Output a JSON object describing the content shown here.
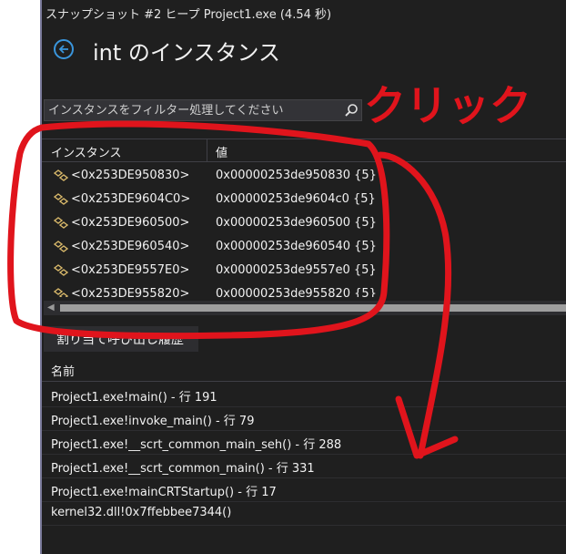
{
  "window": {
    "title": "スナップショット #2 ヒープ Project1.exe (4.54 秒)"
  },
  "page": {
    "title": "int のインスタンス"
  },
  "filter": {
    "placeholder": "インスタンスをフィルター処理してください"
  },
  "table": {
    "headers": {
      "instance": "インスタンス",
      "value": "値"
    },
    "rows": [
      {
        "instance": "<0x253DE950830>",
        "value": "0x00000253de950830 {5}"
      },
      {
        "instance": "<0x253DE9604C0>",
        "value": "0x00000253de9604c0 {5}"
      },
      {
        "instance": "<0x253DE960500>",
        "value": "0x00000253de960500 {5}"
      },
      {
        "instance": "<0x253DE960540>",
        "value": "0x00000253de960540 {5}"
      },
      {
        "instance": "<0x253DE9557E0>",
        "value": "0x00000253de9557e0 {5}"
      },
      {
        "instance": "<0x253DE955820>",
        "value": "0x00000253de955820 {5}"
      }
    ]
  },
  "callstack": {
    "tab_label": "割り当て呼び出し履歴",
    "header": "名前",
    "rows": [
      "Project1.exe!main() - 行 191",
      "Project1.exe!invoke_main() - 行 79",
      "Project1.exe!__scrt_common_main_seh() - 行 288",
      "Project1.exe!__scrt_common_main() - 行 331",
      "Project1.exe!mainCRTStartup() - 行 17",
      "kernel32.dll!0x7ffebbee7344()"
    ]
  },
  "annotation": {
    "text": "クリック",
    "color": "#e0141c"
  },
  "colors": {
    "background": "#1f1f1f",
    "accent": "#3a96dd"
  }
}
